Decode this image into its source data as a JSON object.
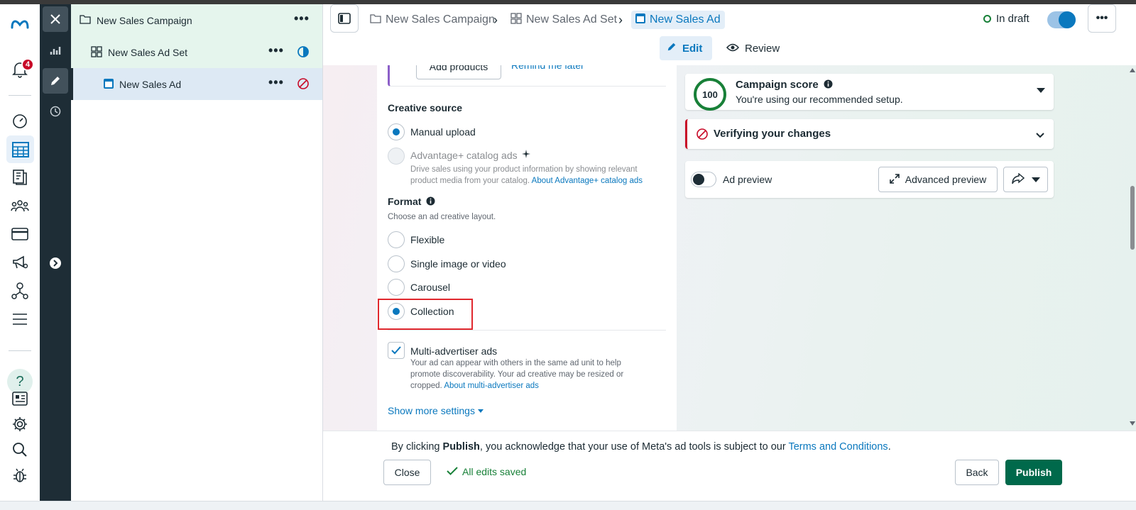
{
  "tree": {
    "campaign": "New Sales Campaign",
    "adset": "New Sales Ad Set",
    "ad": "New Sales Ad",
    "more": "•••"
  },
  "rail": {
    "notifications_badge": "4"
  },
  "topbar": {
    "breadcrumbs": [
      "New Sales Campaign",
      "New Sales Ad Set",
      "New Sales Ad"
    ],
    "status": "In draft",
    "more": "•••",
    "edit": "Edit",
    "review": "Review"
  },
  "form": {
    "add_products": "Add products",
    "remind_later": "Remind me later",
    "creative_source_title": "Creative source",
    "manual_upload": "Manual upload",
    "catalog_ads": "Advantage+ catalog ads",
    "catalog_desc_1": "Drive sales using your product information by showing relevant",
    "catalog_desc_2": "product media from your catalog.",
    "catalog_link": "About Advantage+ catalog ads",
    "format_title": "Format",
    "format_desc": "Choose an ad creative layout.",
    "formats": [
      "Flexible",
      "Single image or video",
      "Carousel",
      "Collection"
    ],
    "selected_format": "Collection",
    "multi_title": "Multi-advertiser ads",
    "multi_desc_1": "Your ad can appear with others in the same ad unit to help",
    "multi_desc_2": "promote discoverability. Your ad creative may be resized or",
    "multi_desc_3": "cropped.",
    "multi_link": "About multi-advertiser ads",
    "show_more": "Show more settings"
  },
  "right": {
    "score": "100",
    "score_title": "Campaign score",
    "score_sub": "You're using our recommended setup.",
    "verify": "Verifying your changes",
    "ad_preview": "Ad preview",
    "advanced_preview": "Advanced preview"
  },
  "footer": {
    "terms_prefix": "By clicking ",
    "terms_bold": "Publish",
    "terms_mid": ", you acknowledge that your use of Meta's ad tools is subject to our ",
    "terms_link": "Terms and Conditions",
    "terms_end": ".",
    "close": "Close",
    "saved": "All edits saved",
    "back": "Back",
    "publish": "Publish"
  },
  "colors": {
    "accent": "#0a78be",
    "publish": "#00694b",
    "success": "#188038",
    "error": "#c80a28"
  }
}
